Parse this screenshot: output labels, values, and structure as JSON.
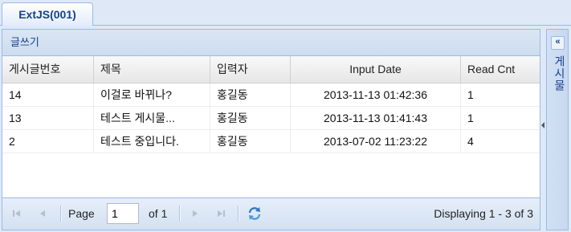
{
  "tabs": [
    {
      "label": "ExtJS(001)"
    }
  ],
  "panel": {
    "title": "글쓰기"
  },
  "grid": {
    "columns": [
      "게시글번호",
      "제목",
      "입력자",
      "Input Date",
      "Read Cnt"
    ],
    "rows": [
      [
        "14",
        "이걸로 바뀌나?",
        "홍길동",
        "2013-11-13 01:42:36",
        "1"
      ],
      [
        "13",
        "테스트 게시물...",
        "홍길동",
        "2013-11-13 01:41:43",
        "1"
      ],
      [
        "2",
        "테스트 중입니다.",
        "홍길동",
        "2013-07-02 11:23:22",
        "4"
      ]
    ]
  },
  "pager": {
    "page_label": "Page",
    "page_value": "1",
    "of_label": "of 1",
    "display_text": "Displaying 1 - 3 of 3",
    "icons": [
      "first-page-icon",
      "prev-page-icon",
      "next-page-icon",
      "last-page-icon",
      "refresh-icon"
    ]
  },
  "side_panel": {
    "title": "게시물",
    "collapse_glyph": "«"
  },
  "colors": {
    "accent": "#15428b",
    "border": "#99bbe8",
    "background": "#dfe8f6"
  }
}
